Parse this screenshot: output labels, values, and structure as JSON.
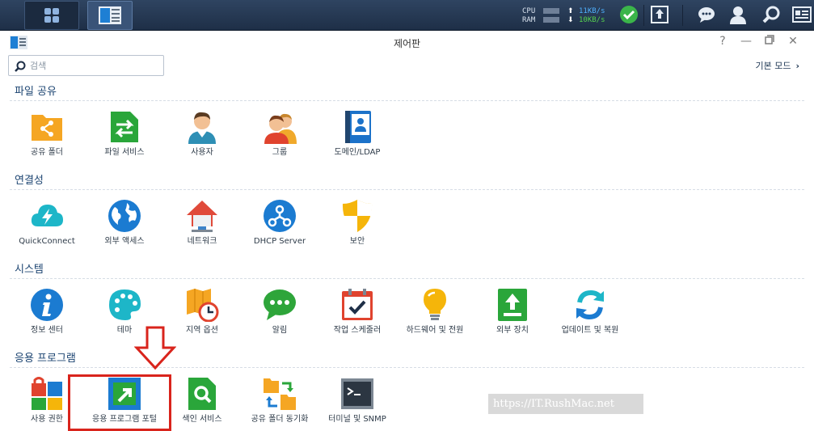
{
  "taskbar": {
    "cpu_label": "CPU",
    "ram_label": "RAM",
    "upload_speed": "11KB/s",
    "download_speed": "10KB/s",
    "upload_arrow": "⬆",
    "download_arrow": "⬇"
  },
  "window": {
    "title": "제어판",
    "help_symbol": "?",
    "minimize_symbol": "—",
    "maximize_symbol": "▫",
    "close_symbol": "✕"
  },
  "search": {
    "placeholder": "검색",
    "value": ""
  },
  "basic_mode": {
    "label": "기본 모드"
  },
  "sections": [
    {
      "title": "파일 공유",
      "items": [
        {
          "label": "공유 폴더",
          "icon": "shared-folder-icon"
        },
        {
          "label": "파일 서비스",
          "icon": "file-services-icon"
        },
        {
          "label": "사용자",
          "icon": "user-icon"
        },
        {
          "label": "그룹",
          "icon": "group-icon"
        },
        {
          "label": "도메인/LDAP",
          "icon": "domain-ldap-icon"
        }
      ]
    },
    {
      "title": "연결성",
      "items": [
        {
          "label": "QuickConnect",
          "icon": "quickconnect-icon"
        },
        {
          "label": "외부 액세스",
          "icon": "external-access-icon"
        },
        {
          "label": "네트워크",
          "icon": "network-icon"
        },
        {
          "label": "DHCP Server",
          "icon": "dhcp-server-icon"
        },
        {
          "label": "보안",
          "icon": "security-icon"
        }
      ]
    },
    {
      "title": "시스템",
      "items": [
        {
          "label": "정보 센터",
          "icon": "info-center-icon"
        },
        {
          "label": "테마",
          "icon": "theme-icon"
        },
        {
          "label": "지역 옵션",
          "icon": "regional-options-icon"
        },
        {
          "label": "알림",
          "icon": "notification-icon"
        },
        {
          "label": "작업 스케줄러",
          "icon": "task-scheduler-icon"
        },
        {
          "label": "하드웨어 및 전원",
          "icon": "hardware-power-icon"
        },
        {
          "label": "외부 장치",
          "icon": "external-devices-icon"
        },
        {
          "label": "업데이트 및 복원",
          "icon": "update-restore-icon"
        }
      ]
    },
    {
      "title": "응용 프로그램",
      "items": [
        {
          "label": "사용 권한",
          "icon": "privileges-icon"
        },
        {
          "label": "응용 프로그램 포털",
          "icon": "application-portal-icon"
        },
        {
          "label": "색인 서비스",
          "icon": "indexing-service-icon"
        },
        {
          "label": "공유 폴더 동기화",
          "icon": "shared-folder-sync-icon"
        },
        {
          "label": "터미널 및 SNMP",
          "icon": "terminal-snmp-icon"
        }
      ]
    }
  ],
  "watermark": "https://IT.RushMac.net",
  "colors": {
    "taskbar_bg": "#263a56",
    "section_title": "#1d4572",
    "highlight": "#d9241c"
  }
}
